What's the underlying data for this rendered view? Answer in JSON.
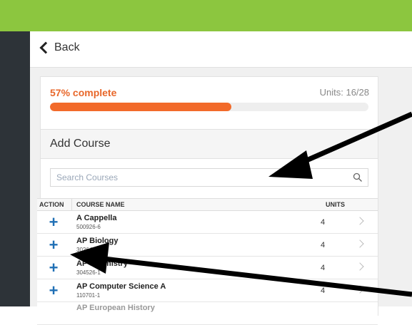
{
  "nav": {
    "back_label": "Back"
  },
  "progress": {
    "percent_text": "57% complete",
    "units_text": "Units: 16/28",
    "fraction": 0.57
  },
  "add_course": {
    "title": "Add Course",
    "search": {
      "placeholder": "Search Courses",
      "value": ""
    },
    "columns": {
      "action": "ACTION",
      "course_name": "COURSE NAME",
      "units": "UNITS"
    },
    "rows": [
      {
        "name": "A Cappella",
        "code": "500926-6",
        "units": "4"
      },
      {
        "name": "AP Biology",
        "code": "302647-1",
        "units": "4"
      },
      {
        "name": "AP Chemistry",
        "code": "304526-1",
        "units": "4"
      },
      {
        "name": "AP Computer Science A",
        "code": "110701-1",
        "units": "4"
      },
      {
        "name": "AP European History",
        "code": "",
        "units": ""
      }
    ]
  },
  "colors": {
    "topbar": "#8cc63f",
    "sidebar": "#2d3338",
    "progress_fill": "#f26a2a",
    "progress_text": "#e8672a",
    "action_plus": "#1f6fb5",
    "annotation_arrow": "#000000"
  },
  "icons": {
    "back": "chevron-left-icon",
    "search": "search-icon",
    "row_chevron": "chevron-right-icon",
    "action": "plus-icon"
  }
}
